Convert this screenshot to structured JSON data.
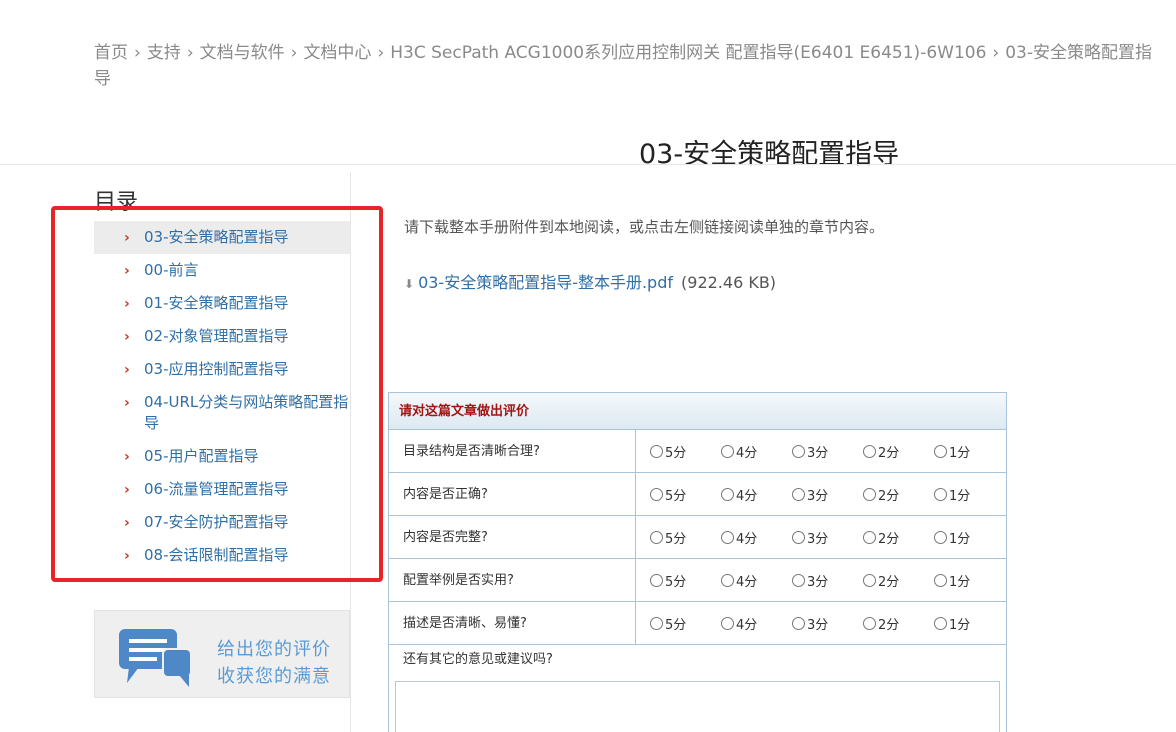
{
  "breadcrumb": {
    "items": [
      "首页",
      "支持",
      "文档与软件",
      "文档中心",
      "H3C SecPath ACG1000系列应用控制网关 配置指导(E6401 E6451)-6W106",
      "03-安全策略配置指导"
    ],
    "separator": "›"
  },
  "page_title": "03-安全策略配置指导",
  "toc": {
    "heading": "目录",
    "items": [
      {
        "label": "03-安全策略配置指导",
        "active": true
      },
      {
        "label": "00-前言"
      },
      {
        "label": "01-安全策略配置指导"
      },
      {
        "label": "02-对象管理配置指导"
      },
      {
        "label": "03-应用控制配置指导"
      },
      {
        "label": "04-URL分类与网站策略配置指导"
      },
      {
        "label": "05-用户配置指导"
      },
      {
        "label": "06-流量管理配置指导"
      },
      {
        "label": "07-安全防护配置指导"
      },
      {
        "label": "08-会话限制配置指导"
      }
    ],
    "chevron": "›"
  },
  "feedback_banner": {
    "line1": "给出您的评价",
    "line2": "收获您的满意"
  },
  "main": {
    "intro": "请下载整本手册附件到本地阅读，或点击左侧链接阅读单独的章节内容。",
    "download": {
      "icon": "download-icon",
      "link_text": "03-安全策略配置指导-整本手册.pdf",
      "size": "(922.46 KB)"
    }
  },
  "rating": {
    "title": "请对这篇文章做出评价",
    "questions": [
      "目录结构是否清晰合理?",
      "内容是否正确?",
      "内容是否完整?",
      "配置举例是否实用?",
      "描述是否清晰、易懂?"
    ],
    "options": [
      "5分",
      "4分",
      "3分",
      "2分",
      "1分"
    ],
    "other_label": "还有其它的意见或建议吗?"
  },
  "colors": {
    "highlight_border": "#e8242a",
    "link": "#2f6fa6",
    "chevron": "#c0392b",
    "rating_title": "#a31515",
    "banner_text": "#5b9bd5"
  }
}
